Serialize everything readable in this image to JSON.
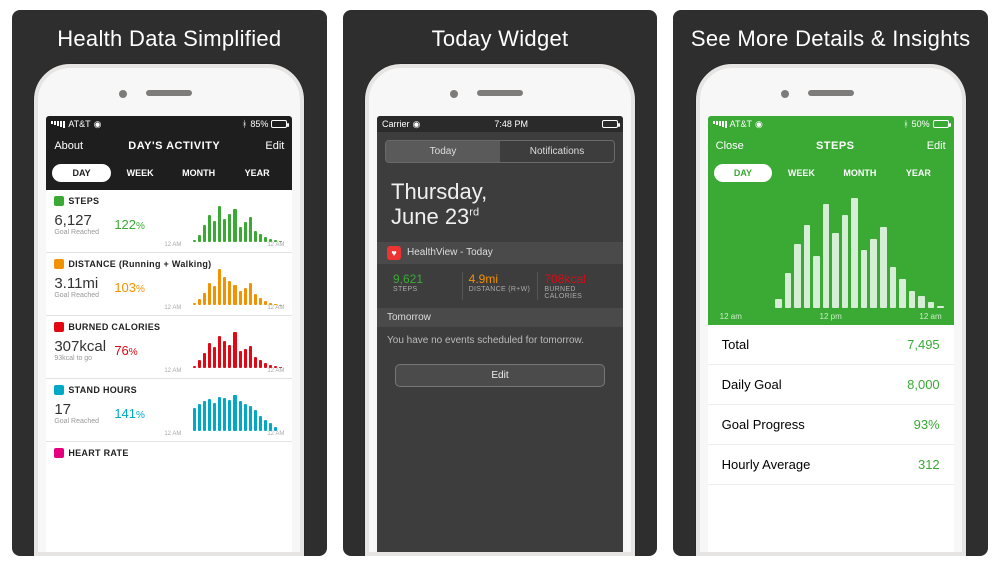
{
  "panels": {
    "p1": {
      "title": "Health Data Simplified"
    },
    "p2": {
      "title": "Today Widget"
    },
    "p3": {
      "title": "See More Details & Insights"
    }
  },
  "colors": {
    "steps": "#3aaa35",
    "distance": "#f39200",
    "calories": "#e30613",
    "stand": "#00a9c6",
    "heartrate": "#e6007e"
  },
  "screen1": {
    "status": {
      "carrier": "AT&T",
      "battery": "85%"
    },
    "nav": {
      "left": "About",
      "title": "DAY'S ACTIVITY",
      "right": "Edit"
    },
    "ranges": [
      "DAY",
      "WEEK",
      "MONTH",
      "YEAR"
    ],
    "axis": {
      "left": "12 AM",
      "right": "12 AM"
    },
    "metrics": {
      "steps": {
        "label": "STEPS",
        "value": "6,127",
        "sub": "Goal Reached",
        "pct": "122",
        "pct_unit": "%"
      },
      "distance": {
        "label": "DISTANCE (Running + Walking)",
        "value": "3.11mi",
        "sub": "Goal Reached",
        "pct": "103",
        "pct_unit": "%"
      },
      "calories": {
        "label": "BURNED CALORIES",
        "value": "307kcal",
        "sub": "93kcal to go",
        "pct": "76",
        "pct_unit": "%"
      },
      "stand": {
        "label": "STAND HOURS",
        "value": "17",
        "sub": "Goal Reached",
        "pct": "141",
        "pct_unit": "%"
      },
      "heartrate": {
        "label": "HEART RATE"
      }
    }
  },
  "screen2": {
    "status": {
      "carrier": "Carrier",
      "time": "7:48 PM"
    },
    "tabs": [
      "Today",
      "Notifications"
    ],
    "date_line1": "Thursday,",
    "date_line2": "June 23",
    "date_suffix": "rd",
    "widget_title": "HealthView - Today",
    "stats": {
      "steps": {
        "value": "9,621",
        "label": "STEPS",
        "color": "#3aaa35"
      },
      "distance": {
        "value": "4.9mi",
        "label": "DISTANCE (R+W)",
        "color": "#f39200"
      },
      "calories": {
        "value": "708kcal",
        "label": "BURNED CALORIES",
        "color": "#e30613"
      }
    },
    "tomorrow_label": "Tomorrow",
    "tomorrow_msg": "You have no events scheduled for tomorrow.",
    "edit": "Edit"
  },
  "screen3": {
    "status": {
      "carrier": "AT&T",
      "battery": "50%"
    },
    "nav": {
      "left": "Close",
      "title": "STEPS",
      "right": "Edit"
    },
    "ranges": [
      "DAY",
      "WEEK",
      "MONTH",
      "YEAR"
    ],
    "axis": [
      "12 am",
      "12 pm",
      "12 am"
    ],
    "rows": {
      "total": {
        "label": "Total",
        "value": "7,495"
      },
      "goal": {
        "label": "Daily Goal",
        "value": "8,000"
      },
      "progress": {
        "label": "Goal Progress",
        "value": "93%"
      },
      "hourly": {
        "label": "Hourly Average",
        "value": "312"
      }
    }
  },
  "chart_data": [
    {
      "type": "bar",
      "title": "Steps (hourly)",
      "screen": 1,
      "metric": "steps",
      "xlabel": "",
      "ylabel": "",
      "categories_note": "24 hourly bars, 12 AM to 12 AM",
      "values": [
        0,
        0,
        0,
        0,
        0,
        0,
        5,
        18,
        45,
        70,
        55,
        95,
        60,
        75,
        88,
        40,
        52,
        66,
        30,
        20,
        12,
        8,
        4,
        2
      ]
    },
    {
      "type": "bar",
      "title": "Distance (hourly)",
      "screen": 1,
      "metric": "distance",
      "values": [
        0,
        0,
        0,
        0,
        0,
        0,
        4,
        15,
        30,
        55,
        48,
        90,
        70,
        60,
        50,
        35,
        42,
        55,
        28,
        18,
        10,
        6,
        3,
        1
      ]
    },
    {
      "type": "bar",
      "title": "Burned Calories (hourly)",
      "screen": 1,
      "metric": "calories",
      "values": [
        0,
        0,
        0,
        0,
        0,
        0,
        6,
        20,
        40,
        65,
        55,
        85,
        72,
        60,
        95,
        45,
        50,
        58,
        30,
        20,
        12,
        8,
        5,
        2
      ]
    },
    {
      "type": "bar",
      "title": "Stand Hours (hourly)",
      "screen": 1,
      "metric": "stand",
      "values": [
        0,
        0,
        0,
        0,
        0,
        0,
        60,
        70,
        80,
        85,
        75,
        90,
        88,
        82,
        95,
        78,
        70,
        65,
        55,
        40,
        30,
        20,
        10,
        0
      ]
    },
    {
      "type": "bar",
      "title": "Steps detail (hourly)",
      "screen": 3,
      "xlabel": "",
      "ylabel": "Steps",
      "x_axis": [
        "12 am",
        "12 pm",
        "12 am"
      ],
      "values": [
        0,
        0,
        0,
        0,
        0,
        0,
        8,
        30,
        55,
        72,
        45,
        90,
        65,
        80,
        95,
        50,
        60,
        70,
        35,
        25,
        15,
        10,
        5,
        2
      ]
    }
  ]
}
